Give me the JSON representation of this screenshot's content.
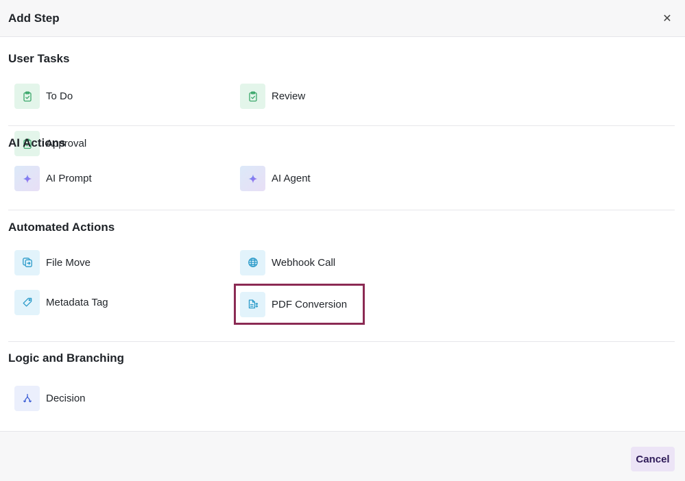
{
  "dialog": {
    "title": "Add Step",
    "close_symbol": "✕"
  },
  "sections": [
    {
      "title": "User Tasks",
      "items": [
        {
          "label": "To Do",
          "icon": "clipboard-check-icon"
        },
        {
          "label": "Review",
          "icon": "clipboard-check-icon"
        },
        {
          "label": "Approval",
          "icon": "clipboard-check-icon"
        }
      ]
    },
    {
      "title": "AI Actions",
      "items": [
        {
          "label": "AI Prompt",
          "icon": "sparkle-icon"
        },
        {
          "label": "AI Agent",
          "icon": "sparkle-icon"
        }
      ]
    },
    {
      "title": "Automated Actions",
      "items": [
        {
          "label": "File Move",
          "icon": "file-move-icon"
        },
        {
          "label": "Webhook Call",
          "icon": "globe-icon"
        },
        {
          "label": "Metadata Tag",
          "icon": "tag-icon"
        },
        {
          "label": "PDF Conversion",
          "icon": "pdf-convert-icon",
          "selected": true
        }
      ]
    },
    {
      "title": "Logic and Branching",
      "items": [
        {
          "label": "Decision",
          "icon": "branch-icon"
        }
      ]
    }
  ],
  "footer": {
    "cancel_label": "Cancel"
  },
  "colors": {
    "selection_outline": "#8b2a53",
    "task_icon": "#3aa66a",
    "ai_icon_start": "#5b8ff0",
    "ai_icon_end": "#b36bf0",
    "automation_icon": "#2a9ac9",
    "logic_icon": "#3d5fd6",
    "cancel_text": "#2e1a58"
  }
}
